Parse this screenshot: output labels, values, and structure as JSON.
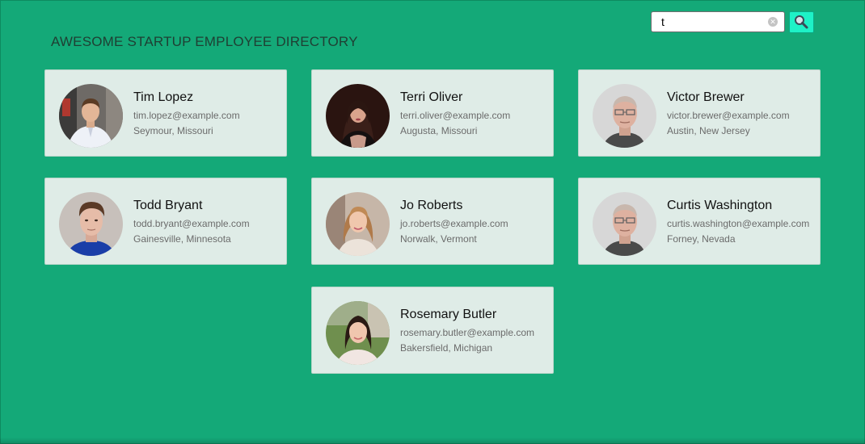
{
  "header": {
    "title": "AWESOME STARTUP EMPLOYEE DIRECTORY"
  },
  "search": {
    "value": "t",
    "placeholder": "",
    "clear_icon": "clear-icon",
    "button_icon": "magnifier-icon"
  },
  "employees": [
    {
      "name": "Tim Lopez",
      "email": "tim.lopez@example.com",
      "location": "Seymour, Missouri"
    },
    {
      "name": "Terri Oliver",
      "email": "terri.oliver@example.com",
      "location": "Augusta, Missouri"
    },
    {
      "name": "Victor Brewer",
      "email": "victor.brewer@example.com",
      "location": "Austin, New Jersey"
    },
    {
      "name": "Todd Bryant",
      "email": "todd.bryant@example.com",
      "location": "Gainesville, Minnesota"
    },
    {
      "name": "Jo Roberts",
      "email": "jo.roberts@example.com",
      "location": "Norwalk, Vermont"
    },
    {
      "name": "Curtis Washington",
      "email": "curtis.washington@example.com",
      "location": "Forney, Nevada"
    },
    {
      "name": "Rosemary Butler",
      "email": "rosemary.butler@example.com",
      "location": "Bakersfield, Michigan"
    }
  ],
  "colors": {
    "background": "#14a978",
    "card": "#dfece7",
    "search_button": "#1ef2c7"
  }
}
